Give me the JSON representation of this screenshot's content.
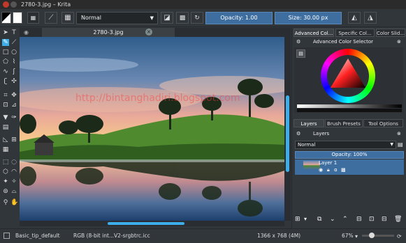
{
  "window": {
    "title": "2780-3.jpg – Krita"
  },
  "toolbar": {
    "blend_mode": "Normal",
    "opacity_label": "Opacity: 1.00",
    "size_label": "Size: 30.00 px"
  },
  "document_tab": {
    "label": "2780-3.jpg",
    "close": "×"
  },
  "watermark": "http://bintanghadiri.blogspot.com",
  "dock": {
    "tabs": [
      "Advanced Col...",
      "Specific Col...",
      "Color Slid..."
    ],
    "color_selector_title": "Advanced Color Selector",
    "middle_tabs": [
      "Layers",
      "Brush Presets",
      "Tool Options"
    ],
    "layers_title": "Layers",
    "layer_blend": "Normal",
    "layer_opacity": "Opacity:  100%",
    "layer_name": "Layer 1"
  },
  "status": {
    "brush": "Basic_tip_default",
    "color_space": "RGB (8-bit int...V2-srgbtrc.icc",
    "dimensions": "1366 x 768 (4M)",
    "zoom": "67%"
  },
  "colors": {
    "accent": "#3daee9",
    "panel": "#31363b",
    "dark": "#232629"
  }
}
